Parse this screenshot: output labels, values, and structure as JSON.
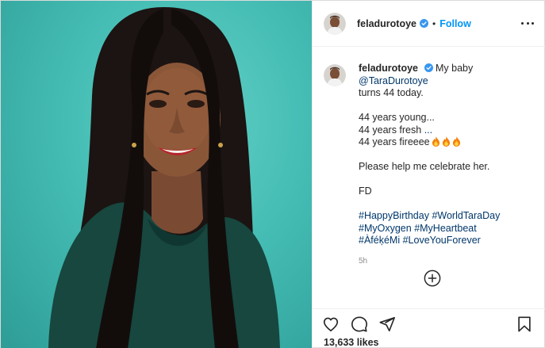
{
  "post": {
    "username": "feladurotoye",
    "follow_label": "Follow",
    "header_separator": "•",
    "caption": {
      "username": "feladurotoye",
      "intro_text": "My baby",
      "mention": "@TaraDurotoye",
      "line_1_end": "turns 44 today.",
      "line_2": "44 years young...",
      "line_3_text": "44 years fresh",
      "line_3_dots": "...",
      "line_4_text": "44 years fireeee",
      "line_5": "Please help me celebrate her.",
      "line_6": "FD",
      "hashtags_row_1": [
        "#HappyBirthday",
        "#WorldTaraDay"
      ],
      "hashtags_row_2": [
        "#MyOxygen",
        "#MyHeartbeat"
      ],
      "hashtags_row_3": [
        "#ÀféķéMi",
        "#LoveYouForever"
      ]
    },
    "time_ago": "5h",
    "likes": "13,633 likes"
  },
  "icons": {
    "verified": "verified-badge-icon",
    "more": "more-options-icon",
    "add_comment": "plus-circle-icon",
    "like": "heart-icon",
    "comment": "comment-bubble-icon",
    "share": "paper-plane-icon",
    "save": "bookmark-icon",
    "flame": "fire-emoji-icon"
  },
  "colors": {
    "link": "#00376b",
    "follow": "#0095f6",
    "verified": "#3897f0",
    "photo_background": "#45bdb4"
  }
}
